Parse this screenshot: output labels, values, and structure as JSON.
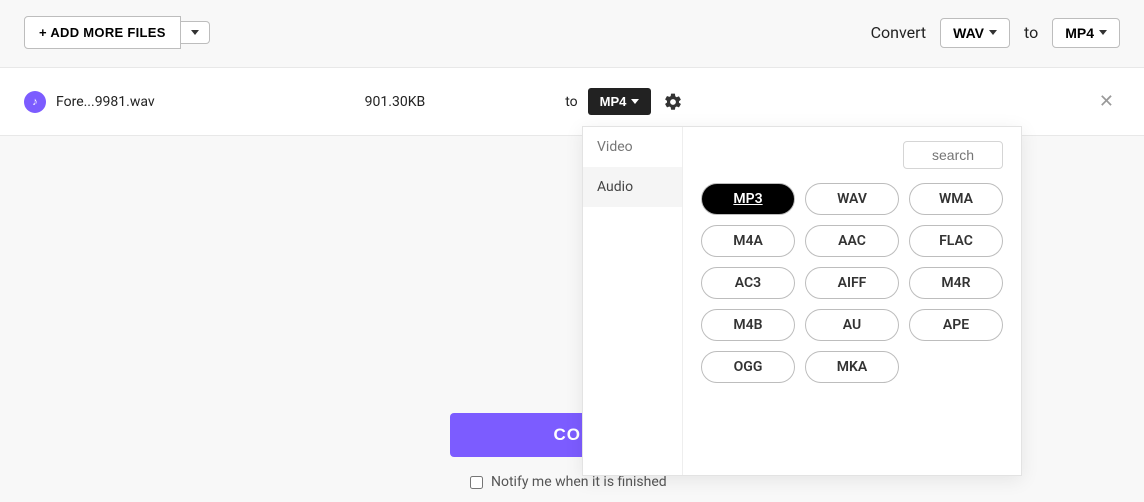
{
  "toolbar": {
    "add_label": "+ ADD MORE FILES"
  },
  "header": {
    "convert_label": "Convert",
    "from_format": "WAV",
    "to_label": "to",
    "to_format": "MP4"
  },
  "file": {
    "name": "Fore...9981.wav",
    "size": "901.30KB",
    "to_label": "to",
    "target": "MP4"
  },
  "dropdown": {
    "tab_video": "Video",
    "tab_audio": "Audio",
    "search_placeholder": "search",
    "formats": [
      "MP3",
      "WAV",
      "WMA",
      "M4A",
      "AAC",
      "FLAC",
      "AC3",
      "AIFF",
      "M4R",
      "M4B",
      "AU",
      "APE",
      "OGG",
      "MKA"
    ],
    "active_format": "MP3"
  },
  "action": {
    "convert_button": "CONV",
    "notify_label": "Notify me when it is finished"
  }
}
